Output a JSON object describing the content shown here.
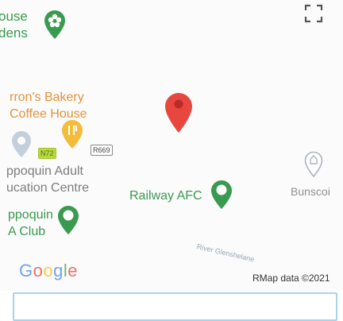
{
  "map": {
    "pois": {
      "garden": {
        "label": "ouse\ndens",
        "icon": "flower-icon"
      },
      "bakery": {
        "label": "rron's Bakery\nCoffee House",
        "icon": "cafe-icon"
      },
      "school": {
        "label": "ppoquin Adult\nucation Centre",
        "icon": "school-icon"
      },
      "afc": {
        "label": "Railway AFC",
        "icon": "sports-icon"
      },
      "club": {
        "label": "ppoquin\nA Club",
        "icon": "sports-icon"
      },
      "worship": {
        "label": "Bunscoi",
        "icon": "place-of-worship-icon"
      }
    },
    "road_label": "River Glenshelane",
    "shields": {
      "green": "N72",
      "white": "R669"
    },
    "selected_marker": {
      "icon": "map-marker-icon",
      "color": "#e8473f"
    },
    "colors": {
      "park_green": "#3a9a4f",
      "food_orange": "#e8913a",
      "school_gray": "#7d7d7d"
    }
  },
  "controls": {
    "fullscreen_icon": "fullscreen-icon"
  },
  "logo": {
    "letters": [
      "G",
      "o",
      "o",
      "g",
      "l",
      "e"
    ],
    "colors": [
      "#4285f4",
      "#ea4335",
      "#fbbc05",
      "#4285f4",
      "#34a853",
      "#ea4335"
    ]
  },
  "attribution": "RMap data ©2021",
  "search": {
    "value": ""
  }
}
